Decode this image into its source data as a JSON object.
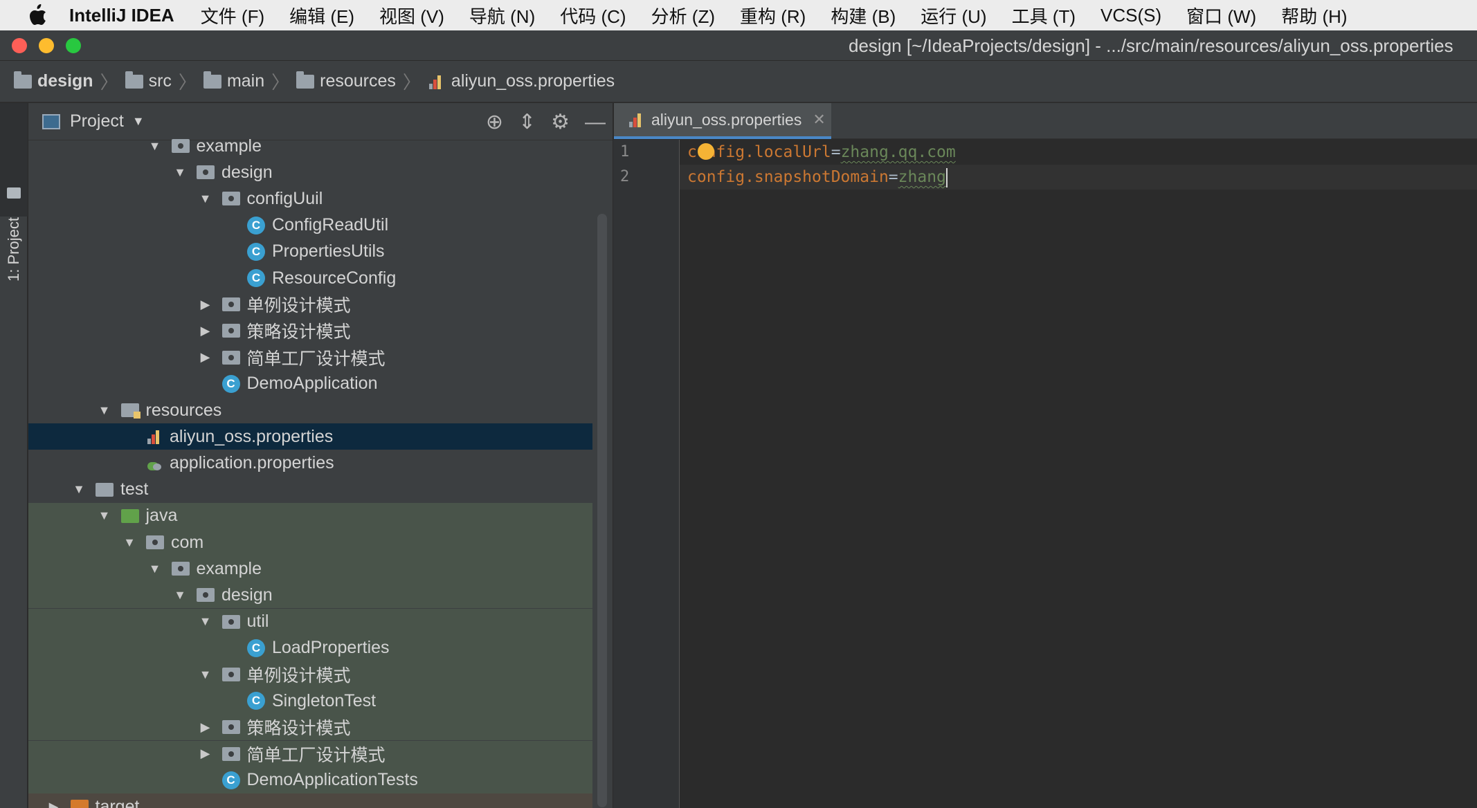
{
  "menubar": {
    "app_name": "IntelliJ IDEA",
    "items": [
      "文件 (F)",
      "编辑 (E)",
      "视图 (V)",
      "导航 (N)",
      "代码 (C)",
      "分析 (Z)",
      "重构 (R)",
      "构建 (B)",
      "运行 (U)",
      "工具 (T)",
      "VCS(S)",
      "窗口 (W)",
      "帮助 (H)"
    ]
  },
  "window": {
    "title": "design [~/IdeaProjects/design] - .../src/main/resources/aliyun_oss.properties"
  },
  "breadcrumbs": [
    "design",
    "src",
    "main",
    "resources",
    "aliyun_oss.properties"
  ],
  "tool_stripe": {
    "label": "1: Project"
  },
  "project_panel": {
    "title": "Project",
    "tree": [
      {
        "label": "example",
        "indent": 5,
        "arrow": "down",
        "icon": "package"
      },
      {
        "label": "design",
        "indent": 6,
        "arrow": "down",
        "icon": "package"
      },
      {
        "label": "configUuil",
        "indent": 7,
        "arrow": "down",
        "icon": "package"
      },
      {
        "label": "ConfigReadUtil",
        "indent": 8,
        "arrow": "none",
        "icon": "class"
      },
      {
        "label": "PropertiesUtils",
        "indent": 8,
        "arrow": "none",
        "icon": "class"
      },
      {
        "label": "ResourceConfig",
        "indent": 8,
        "arrow": "none",
        "icon": "class"
      },
      {
        "label": "单例设计模式",
        "indent": 7,
        "arrow": "right",
        "icon": "package"
      },
      {
        "label": "策略设计模式",
        "indent": 7,
        "arrow": "right",
        "icon": "package"
      },
      {
        "label": "简单工厂设计模式",
        "indent": 7,
        "arrow": "right",
        "icon": "package"
      },
      {
        "label": "DemoApplication",
        "indent": 7,
        "arrow": "none",
        "icon": "spring-class"
      },
      {
        "label": "resources",
        "indent": 3,
        "arrow": "down",
        "icon": "resources"
      },
      {
        "label": "aliyun_oss.properties",
        "indent": 4,
        "arrow": "none",
        "icon": "properties",
        "selected": true
      },
      {
        "label": "application.properties",
        "indent": 4,
        "arrow": "none",
        "icon": "spring-properties"
      },
      {
        "label": "test",
        "indent": 2,
        "arrow": "down",
        "icon": "folder"
      },
      {
        "label": "java",
        "indent": 3,
        "arrow": "down",
        "icon": "test-folder",
        "test": true
      },
      {
        "label": "com",
        "indent": 4,
        "arrow": "down",
        "icon": "package",
        "test": true
      },
      {
        "label": "example",
        "indent": 5,
        "arrow": "down",
        "icon": "package",
        "test": true
      },
      {
        "label": "design",
        "indent": 6,
        "arrow": "down",
        "icon": "package",
        "test": true
      },
      {
        "label": "util",
        "indent": 7,
        "arrow": "down",
        "icon": "package",
        "test": true
      },
      {
        "label": "LoadProperties",
        "indent": 8,
        "arrow": "none",
        "icon": "test-class",
        "test": true
      },
      {
        "label": "单例设计模式",
        "indent": 7,
        "arrow": "down",
        "icon": "package",
        "test": true
      },
      {
        "label": "SingletonTest",
        "indent": 8,
        "arrow": "none",
        "icon": "test-class",
        "test": true
      },
      {
        "label": "策略设计模式",
        "indent": 7,
        "arrow": "right",
        "icon": "package",
        "test": true
      },
      {
        "label": "简单工厂设计模式",
        "indent": 7,
        "arrow": "right",
        "icon": "package",
        "test": true
      },
      {
        "label": "DemoApplicationTests",
        "indent": 7,
        "arrow": "none",
        "icon": "test-class",
        "test": true
      },
      {
        "label": "target",
        "indent": 1,
        "arrow": "right",
        "icon": "excluded-folder",
        "target": true
      }
    ]
  },
  "editor": {
    "tab_label": "aliyun_oss.properties",
    "lines": [
      {
        "number": "1",
        "key": "config.localUrl",
        "value": "zhang.qq.com"
      },
      {
        "number": "2",
        "key": "config.snapshotDomain",
        "value": "zhang"
      }
    ]
  },
  "colors": {
    "accent": "#4a88c7",
    "selection": "#0d293e",
    "test_background": "#49544a",
    "key": "#cc7832",
    "value": "#6a8759"
  }
}
